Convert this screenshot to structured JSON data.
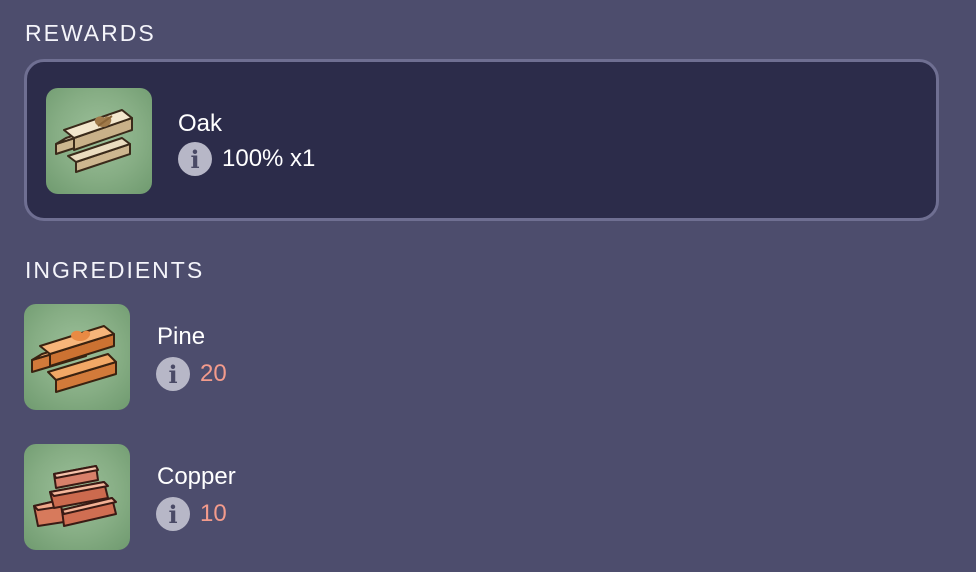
{
  "rewards": {
    "title": "REWARDS",
    "items": [
      {
        "name": "Oak",
        "amount": "100% x1",
        "icon": "oak-planks-icon"
      }
    ]
  },
  "ingredients": {
    "title": "INGREDIENTS",
    "items": [
      {
        "name": "Pine",
        "amount": "20",
        "icon": "pine-planks-icon"
      },
      {
        "name": "Copper",
        "amount": "10",
        "icon": "copper-bars-icon"
      }
    ]
  },
  "colors": {
    "background": "#4d4d6d",
    "card": "#2c2c4a",
    "card_border": "#6f6f92",
    "icon_bg": "#86ad84",
    "ingredient_amount": "#f39b8c",
    "info_icon": "#b7b7c7"
  },
  "info_glyph": "i"
}
